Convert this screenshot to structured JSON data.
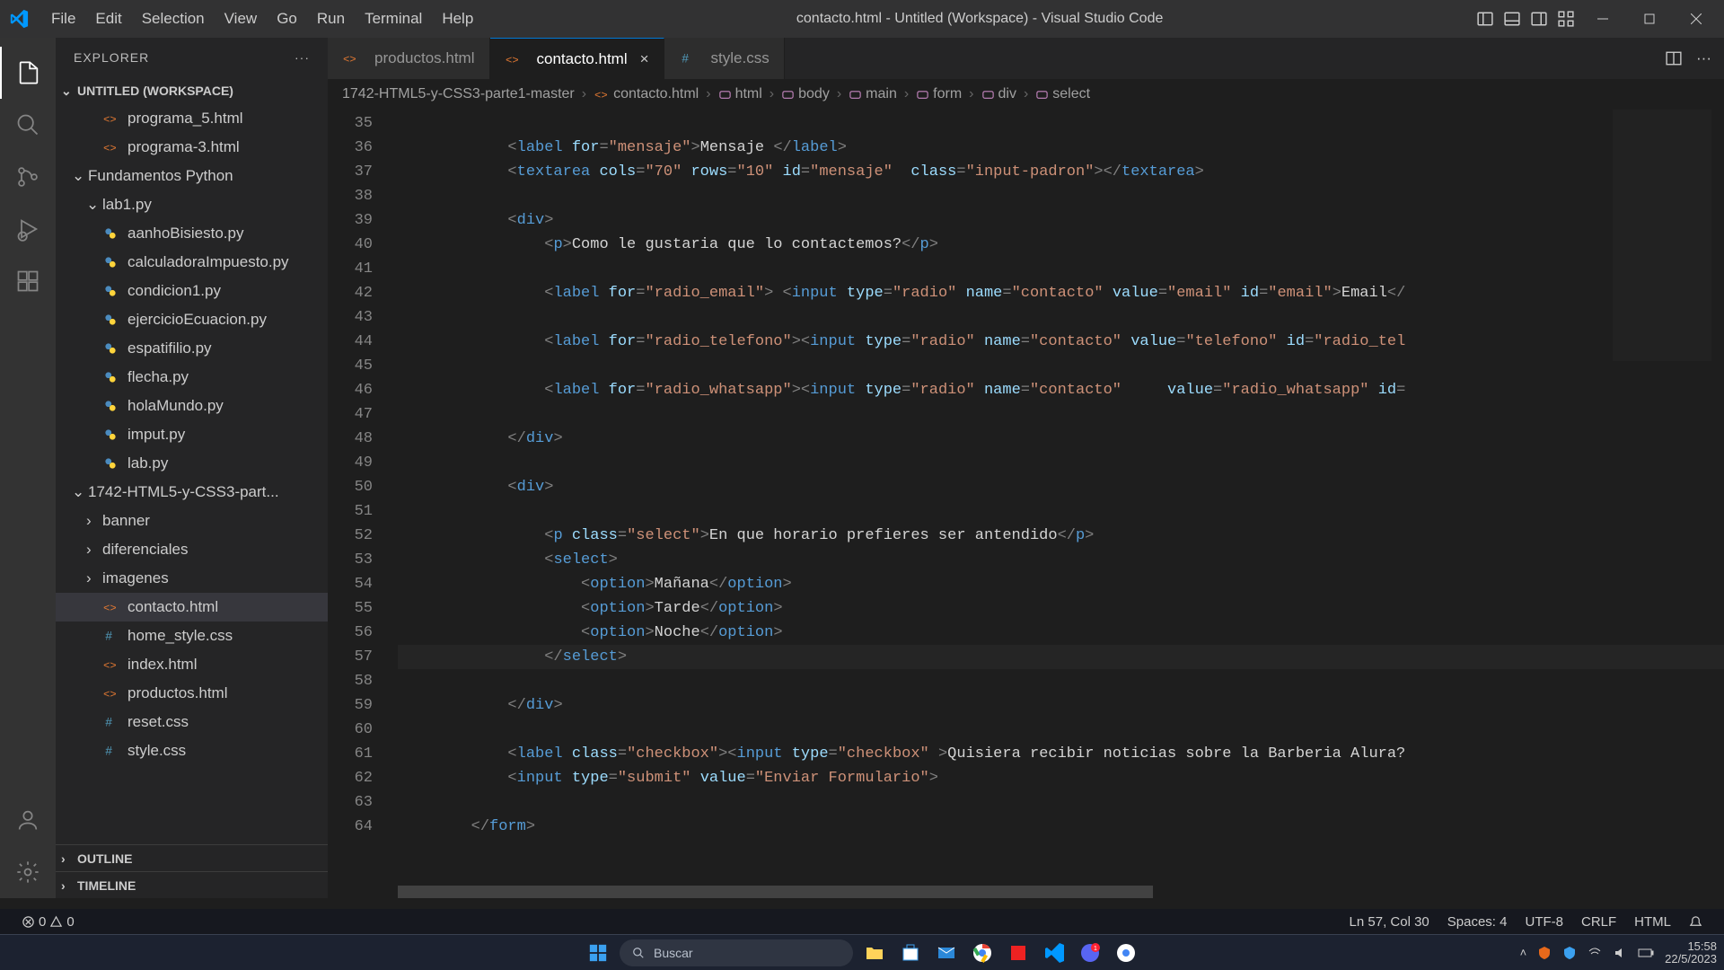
{
  "window": {
    "title": "contacto.html - Untitled (Workspace) - Visual Studio Code"
  },
  "menu": [
    "File",
    "Edit",
    "Selection",
    "View",
    "Go",
    "Run",
    "Terminal",
    "Help"
  ],
  "sidebar": {
    "header": "EXPLORER",
    "workspace": "UNTITLED (WORKSPACE)",
    "tree": [
      {
        "t": "file",
        "depth": 2,
        "name": "programa_5.html",
        "icon": "html"
      },
      {
        "t": "file",
        "depth": 2,
        "name": "programa-3.html",
        "icon": "html"
      },
      {
        "t": "folder",
        "depth": 1,
        "name": "Fundamentos Python",
        "open": true
      },
      {
        "t": "folder",
        "depth": 2,
        "name": "lab1.py",
        "open": true
      },
      {
        "t": "file",
        "depth": 2,
        "name": "aanhoBisiesto.py",
        "icon": "py"
      },
      {
        "t": "file",
        "depth": 2,
        "name": "calculadoraImpuesto.py",
        "icon": "py"
      },
      {
        "t": "file",
        "depth": 2,
        "name": "condicion1.py",
        "icon": "py"
      },
      {
        "t": "file",
        "depth": 2,
        "name": "ejercicioEcuacion.py",
        "icon": "py"
      },
      {
        "t": "file",
        "depth": 2,
        "name": "espatifilio.py",
        "icon": "py"
      },
      {
        "t": "file",
        "depth": 2,
        "name": "flecha.py",
        "icon": "py"
      },
      {
        "t": "file",
        "depth": 2,
        "name": "holaMundo.py",
        "icon": "py"
      },
      {
        "t": "file",
        "depth": 2,
        "name": "imput.py",
        "icon": "py"
      },
      {
        "t": "file",
        "depth": 2,
        "name": "lab.py",
        "icon": "py"
      },
      {
        "t": "folder",
        "depth": 1,
        "name": "1742-HTML5-y-CSS3-part...",
        "open": true
      },
      {
        "t": "folder",
        "depth": 2,
        "name": "banner",
        "open": false
      },
      {
        "t": "folder",
        "depth": 2,
        "name": "diferenciales",
        "open": false
      },
      {
        "t": "folder",
        "depth": 2,
        "name": "imagenes",
        "open": false
      },
      {
        "t": "file",
        "depth": 2,
        "name": "contacto.html",
        "icon": "html",
        "selected": true
      },
      {
        "t": "file",
        "depth": 2,
        "name": "home_style.css",
        "icon": "css"
      },
      {
        "t": "file",
        "depth": 2,
        "name": "index.html",
        "icon": "html"
      },
      {
        "t": "file",
        "depth": 2,
        "name": "productos.html",
        "icon": "html"
      },
      {
        "t": "file",
        "depth": 2,
        "name": "reset.css",
        "icon": "css"
      },
      {
        "t": "file",
        "depth": 2,
        "name": "style.css",
        "icon": "css"
      }
    ],
    "outline": "OUTLINE",
    "timeline": "TIMELINE"
  },
  "tabs": [
    {
      "label": "productos.html",
      "icon": "html",
      "active": false
    },
    {
      "label": "contacto.html",
      "icon": "html",
      "active": true
    },
    {
      "label": "style.css",
      "icon": "css",
      "active": false
    }
  ],
  "breadcrumbs": [
    {
      "l": "1742-HTML5-y-CSS3-parte1-master"
    },
    {
      "l": "contacto.html",
      "i": "html"
    },
    {
      "l": "html",
      "i": "sym"
    },
    {
      "l": "body",
      "i": "sym"
    },
    {
      "l": "main",
      "i": "sym"
    },
    {
      "l": "form",
      "i": "sym"
    },
    {
      "l": "div",
      "i": "sym"
    },
    {
      "l": "select",
      "i": "sym"
    }
  ],
  "code": {
    "start": 35,
    "current_line": 57,
    "lines": [
      {
        "n": 35,
        "html": ""
      },
      {
        "n": 36,
        "html": "            <span class='tagb'>&lt;</span><span class='tag'>label</span> <span class='attr'>for</span><span class='pun'>=</span><span class='str'>\"mensaje\"</span><span class='tagb'>&gt;</span><span class='txt'>Mensaje </span><span class='tagb'>&lt;/</span><span class='tag'>label</span><span class='tagb'>&gt;</span>"
      },
      {
        "n": 37,
        "html": "            <span class='tagb'>&lt;</span><span class='tag'>textarea</span> <span class='attr'>cols</span><span class='pun'>=</span><span class='str'>\"70\"</span> <span class='attr'>rows</span><span class='pun'>=</span><span class='str'>\"10\"</span> <span class='attr'>id</span><span class='pun'>=</span><span class='str'>\"mensaje\"</span>  <span class='attr'>class</span><span class='pun'>=</span><span class='str'>\"input-padron\"</span><span class='tagb'>&gt;&lt;/</span><span class='tag'>textarea</span><span class='tagb'>&gt;</span>"
      },
      {
        "n": 38,
        "html": ""
      },
      {
        "n": 39,
        "html": "            <span class='tagb'>&lt;</span><span class='tag'>div</span><span class='tagb'>&gt;</span>"
      },
      {
        "n": 40,
        "html": "                <span class='tagb'>&lt;</span><span class='tag'>p</span><span class='tagb'>&gt;</span><span class='txt'>Como le gustaria que lo contactemos?</span><span class='tagb'>&lt;/</span><span class='tag'>p</span><span class='tagb'>&gt;</span>"
      },
      {
        "n": 41,
        "html": ""
      },
      {
        "n": 42,
        "html": "                <span class='tagb'>&lt;</span><span class='tag'>label</span> <span class='attr'>for</span><span class='pun'>=</span><span class='str'>\"radio_email\"</span><span class='tagb'>&gt;</span> <span class='tagb'>&lt;</span><span class='tag'>input</span> <span class='attr'>type</span><span class='pun'>=</span><span class='str'>\"radio\"</span> <span class='attr'>name</span><span class='pun'>=</span><span class='str'>\"contacto\"</span> <span class='attr'>value</span><span class='pun'>=</span><span class='str'>\"email\"</span> <span class='attr'>id</span><span class='pun'>=</span><span class='str'>\"email\"</span><span class='tagb'>&gt;</span><span class='txt'>Email</span><span class='tagb'>&lt;/</span>"
      },
      {
        "n": 43,
        "html": ""
      },
      {
        "n": 44,
        "html": "                <span class='tagb'>&lt;</span><span class='tag'>label</span> <span class='attr'>for</span><span class='pun'>=</span><span class='str'>\"radio_telefono\"</span><span class='tagb'>&gt;</span><span class='tagb'>&lt;</span><span class='tag'>input</span> <span class='attr'>type</span><span class='pun'>=</span><span class='str'>\"radio\"</span> <span class='attr'>name</span><span class='pun'>=</span><span class='str'>\"contacto\"</span> <span class='attr'>value</span><span class='pun'>=</span><span class='str'>\"telefono\"</span> <span class='attr'>id</span><span class='pun'>=</span><span class='str'>\"radio_tel</span>"
      },
      {
        "n": 45,
        "html": ""
      },
      {
        "n": 46,
        "html": "                <span class='tagb'>&lt;</span><span class='tag'>label</span> <span class='attr'>for</span><span class='pun'>=</span><span class='str'>\"radio_whatsapp\"</span><span class='tagb'>&gt;</span><span class='tagb'>&lt;</span><span class='tag'>input</span> <span class='attr'>type</span><span class='pun'>=</span><span class='str'>\"radio\"</span> <span class='attr'>name</span><span class='pun'>=</span><span class='str'>\"contacto\"</span>     <span class='attr'>value</span><span class='pun'>=</span><span class='str'>\"radio_whatsapp\"</span> <span class='attr'>id</span><span class='pun'>=</span>"
      },
      {
        "n": 47,
        "html": ""
      },
      {
        "n": 48,
        "html": "            <span class='tagb'>&lt;/</span><span class='tag'>div</span><span class='tagb'>&gt;</span>"
      },
      {
        "n": 49,
        "html": ""
      },
      {
        "n": 50,
        "html": "            <span class='tagb'>&lt;</span><span class='tag'>div</span><span class='tagb'>&gt;</span>"
      },
      {
        "n": 51,
        "html": ""
      },
      {
        "n": 52,
        "html": "                <span class='tagb'>&lt;</span><span class='tag'>p</span> <span class='attr'>class</span><span class='pun'>=</span><span class='str'>\"select\"</span><span class='tagb'>&gt;</span><span class='txt'>En que horario prefieres ser antendido</span><span class='tagb'>&lt;/</span><span class='tag'>p</span><span class='tagb'>&gt;</span>"
      },
      {
        "n": 53,
        "html": "                <span class='tagb'>&lt;</span><span class='tag'>select</span><span class='tagb'>&gt;</span>"
      },
      {
        "n": 54,
        "html": "                    <span class='tagb'>&lt;</span><span class='tag'>option</span><span class='tagb'>&gt;</span><span class='txt'>Mañana</span><span class='tagb'>&lt;/</span><span class='tag'>option</span><span class='tagb'>&gt;</span>"
      },
      {
        "n": 55,
        "html": "                    <span class='tagb'>&lt;</span><span class='tag'>option</span><span class='tagb'>&gt;</span><span class='txt'>Tarde</span><span class='tagb'>&lt;/</span><span class='tag'>option</span><span class='tagb'>&gt;</span>"
      },
      {
        "n": 56,
        "html": "                    <span class='tagb'>&lt;</span><span class='tag'>option</span><span class='tagb'>&gt;</span><span class='txt'>Noche</span><span class='tagb'>&lt;/</span><span class='tag'>option</span><span class='tagb'>&gt;</span>"
      },
      {
        "n": 57,
        "html": "                <span class='tagb'>&lt;/</span><span class='tag'>select</span><span class='tagb'>&gt;</span>"
      },
      {
        "n": 58,
        "html": ""
      },
      {
        "n": 59,
        "html": "            <span class='tagb'>&lt;/</span><span class='tag'>div</span><span class='tagb'>&gt;</span>"
      },
      {
        "n": 60,
        "html": ""
      },
      {
        "n": 61,
        "html": "            <span class='tagb'>&lt;</span><span class='tag'>label</span> <span class='attr'>class</span><span class='pun'>=</span><span class='str'>\"checkbox\"</span><span class='tagb'>&gt;</span><span class='tagb'>&lt;</span><span class='tag'>input</span> <span class='attr'>type</span><span class='pun'>=</span><span class='str'>\"checkbox\"</span> <span class='tagb'>&gt;</span><span class='txt'>Quisiera recibir noticias sobre la Barberia Alura?</span>"
      },
      {
        "n": 62,
        "html": "            <span class='tagb'>&lt;</span><span class='tag'>input</span> <span class='attr'>type</span><span class='pun'>=</span><span class='str'>\"submit\"</span> <span class='attr'>value</span><span class='pun'>=</span><span class='str'>\"Enviar Formulario\"</span><span class='tagb'>&gt;</span>"
      },
      {
        "n": 63,
        "html": ""
      },
      {
        "n": 64,
        "html": "        <span class='tagb'>&lt;/</span><span class='tag'>form</span><span class='tagb'>&gt;</span>"
      }
    ]
  },
  "status": {
    "errors": "0",
    "warnings": "0",
    "pos": "Ln 57, Col 30",
    "spaces": "Spaces: 4",
    "enc": "UTF-8",
    "eol": "CRLF",
    "lang": "HTML"
  },
  "taskbar": {
    "search_placeholder": "Buscar",
    "time": "15:58",
    "date": "22/5/2023"
  }
}
